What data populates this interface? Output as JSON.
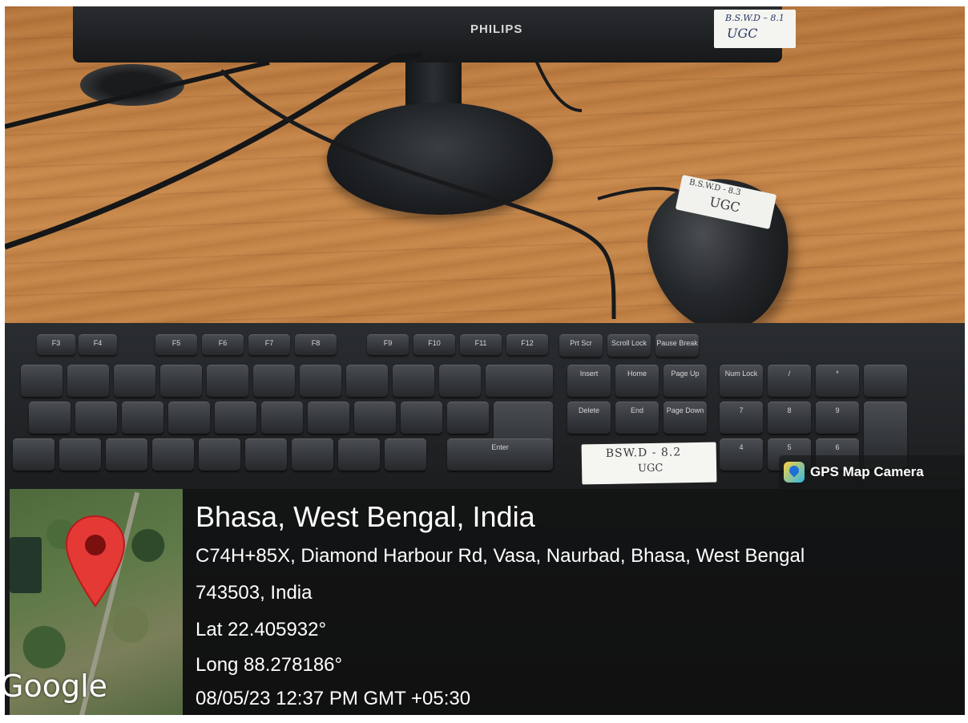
{
  "scene": {
    "monitor_brand": "PHILIPS",
    "monitor_sticker": {
      "line1": "B.S.W.D – 8.1",
      "line2": "UGC"
    },
    "mouse_sticker": {
      "line1": "B.S.W.D - 8.3",
      "line2": "UGC"
    },
    "keyboard_sticker": {
      "line1": "BSW.D - 8.2",
      "line2": "UGC"
    },
    "keys": [
      "F3",
      "F4",
      "F5",
      "F6",
      "F7",
      "F8",
      "F9",
      "F10",
      "F11",
      "F12",
      "Prt Scr",
      "Scroll Lock",
      "Pause Break",
      "Insert",
      "Home",
      "Page Up",
      "Delete",
      "End",
      "Page Down",
      "Enter",
      "Num Lock",
      "/",
      "*",
      "7",
      "8",
      "9",
      "4",
      "5",
      "6"
    ]
  },
  "gps": {
    "app_label": "GPS Map Camera",
    "map_brand": "Google",
    "place_title": "Bhasa, West Bengal, India",
    "address_line1": "C74H+85X, Diamond Harbour Rd, Vasa, Naurbad, Bhasa, West Bengal",
    "address_line2": "743503, India",
    "latitude": "Lat 22.405932°",
    "longitude": "Long 88.278186°",
    "timestamp": "08/05/23 12:37 PM GMT +05:30"
  }
}
